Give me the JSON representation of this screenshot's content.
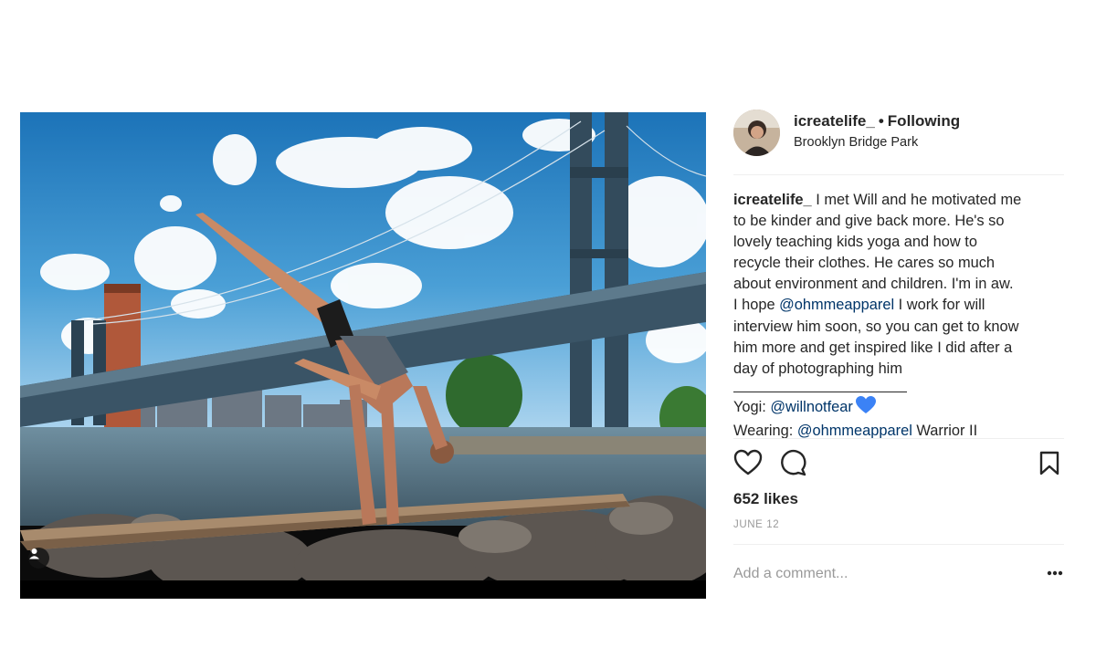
{
  "post": {
    "username": "icreatelife_",
    "separator": "•",
    "follow_status": "Following",
    "location": "Brooklyn Bridge Park"
  },
  "caption": {
    "username": "icreatelife_",
    "line1_text": " I met Will and he motivated me",
    "line2": "to be kinder and give back more. He's so",
    "line3": "lovely teaching kids yoga and how to",
    "line4": "recycle their clothes. He cares so much",
    "line5": "about environment and children. I'm in aw.",
    "line6_pre": "I hope ",
    "line6_mention": "@ohmmeapparel",
    "line6_post": " I work for will",
    "line7": "interview him soon, so you can get to know",
    "line8": "him more and get inspired like I did after a",
    "line9": "day of photographing him"
  },
  "credits": {
    "yogi_label": "Yogi: ",
    "yogi_mention": "@willnotfear",
    "wearing_label": "Wearing: ",
    "wearing_mention": "@ohmmeapparel",
    "wearing_post": " Warrior II"
  },
  "stats": {
    "likes": "652 likes",
    "date": "JUNE 12"
  },
  "comment": {
    "placeholder": "Add a comment..."
  },
  "icons": {
    "like": "heart-outline-icon",
    "comment": "speech-bubble-icon",
    "save": "bookmark-icon",
    "more": "ellipsis-icon",
    "tag": "person-tag-icon",
    "emoji": "blue-heart-icon"
  },
  "colors": {
    "text": "#262626",
    "mention": "#003569",
    "muted": "#999999",
    "divider": "#efefef",
    "emoji_heart": "#3b82f6"
  }
}
